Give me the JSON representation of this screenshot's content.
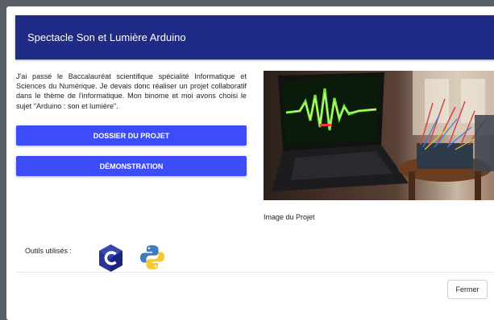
{
  "modal": {
    "title": "Spectacle Son et Lumière Arduino",
    "description": "J'ai passé le Baccalauréat scientifique spécialité Informatique et Sciences du Numérique. Je devais donc réaliser un projet collaboratif dans le thème de l'informatique. Mon binome et moi avons choisi le sujet \"Arduino : son et lumière\".",
    "buttons": {
      "dossier": "DOSSIER DU PROJET",
      "demo": "DÉMONSTRATION"
    },
    "image_caption": "Image du Projet",
    "tools": {
      "label": "Outils utilisés :",
      "icons": [
        "c-language-icon",
        "python-icon"
      ]
    },
    "close_label": "Fermer"
  },
  "colors": {
    "header": "#1f2c87",
    "button": "#3b4cf8",
    "backdrop": "#5b6068"
  }
}
